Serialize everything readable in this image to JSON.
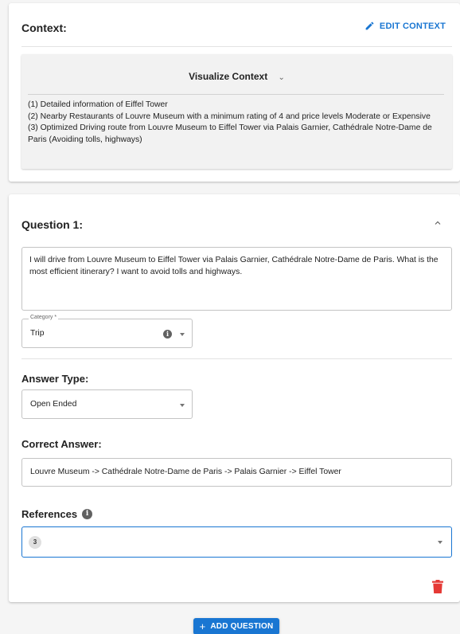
{
  "context": {
    "title": "Context:",
    "edit_label": "EDIT CONTEXT",
    "visualize_label": "Visualize Context",
    "items": [
      "(1) Detailed information of Eiffel Tower",
      "(2) Nearby Restaurants of Louvre Museum with a minimum rating of 4 and price levels Moderate or Expensive",
      "(3) Optimized Driving route from Louvre Museum to Eiffel Tower via Palais Garnier, Cathédrale Notre-Dame de Paris (Avoiding tolls, highways)"
    ]
  },
  "question": {
    "title": "Question 1:",
    "text": "I will drive from Louvre Museum to Eiffel Tower via Palais Garnier, Cathédrale Notre-Dame de Paris. What is the most efficient itinerary? I want to avoid tolls and highways.",
    "category": {
      "label": "Category *",
      "value": "Trip"
    },
    "answer_type": {
      "label": "Answer Type:",
      "value": "Open Ended"
    },
    "correct_answer": {
      "label": "Correct Answer:",
      "value": "Louvre Museum -> Cathédrale Notre-Dame de Paris -> Palais Garnier -> Eiffel Tower"
    },
    "references": {
      "label": "References",
      "selected": [
        "3"
      ]
    }
  },
  "add_question_label": "ADD QUESTION",
  "colors": {
    "primary": "#1976d2",
    "danger": "#e53935",
    "background": "#f5f5f5"
  }
}
